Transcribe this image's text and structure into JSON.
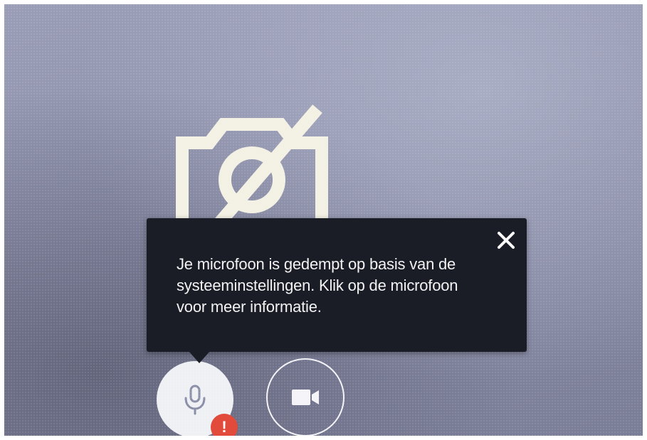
{
  "notification": {
    "message": "Je microfoon is gedempt op basis van de systeeminstellingen. Klik op de microfoon voor meer informatie."
  },
  "controls": {
    "mic_alert_badge": "!"
  },
  "icons": {
    "camera_off": "camera-off-icon",
    "close": "close-icon",
    "microphone": "microphone-icon",
    "video_camera": "video-camera-icon"
  },
  "colors": {
    "tooltip_background": "#1a1c26",
    "alert_badge": "#e24a3b",
    "mic_button_background": "#eef0f4",
    "icon_cream": "#f3f0e4"
  }
}
